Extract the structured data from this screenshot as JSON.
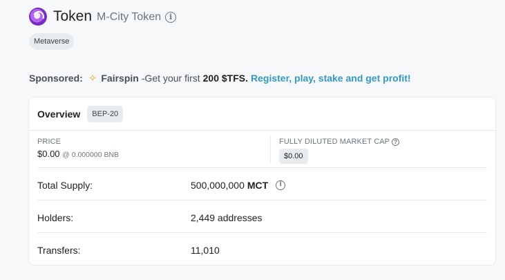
{
  "header": {
    "title": "Token",
    "subtitle": "M-City Token",
    "tag": "Metaverse"
  },
  "sponsored": {
    "label": "Sponsored:",
    "brand": "Fairspin",
    "text": "-Get your first",
    "bold": "200 $TFS.",
    "link": "Register, play, stake and get profit!"
  },
  "overview": {
    "title": "Overview",
    "badge": "BEP-20",
    "price": {
      "label": "PRICE",
      "value": "$0.00",
      "sub": "@ 0.000000 BNB"
    },
    "market_cap": {
      "label": "FULLY DILUTED MARKET CAP",
      "value": "$0.00"
    },
    "rows": [
      {
        "key": "Total Supply:",
        "value": "500,000,000",
        "symbol": "MCT"
      },
      {
        "key": "Holders:",
        "value": "2,449 addresses"
      },
      {
        "key": "Transfers:",
        "value": "11,010"
      }
    ]
  },
  "icons": {
    "token_logo": "token-logo-icon",
    "info": "info-icon",
    "question": "question-icon",
    "sponsor": "fairspin-icon"
  },
  "colors": {
    "link": "#3498c1",
    "background": "#f7f8f9",
    "card_border": "#e7eaf3"
  }
}
